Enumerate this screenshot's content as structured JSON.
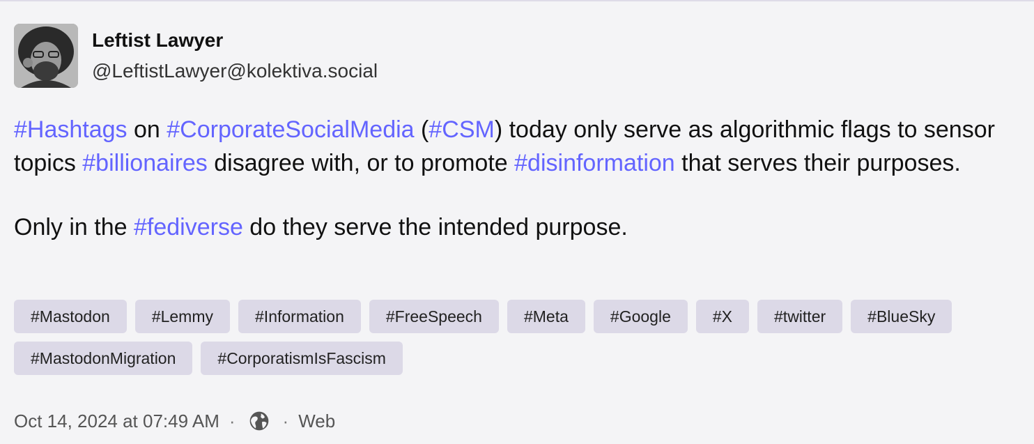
{
  "author": {
    "display_name": "Leftist Lawyer",
    "handle": "@LeftistLawyer@kolektiva.social",
    "avatar_icon": "avatar-photo"
  },
  "post": {
    "p1": {
      "tag_hashtags": "#Hashtags",
      "t_on": " on ",
      "tag_csm_full": "#CorporateSocialMedia",
      "t_open": " (",
      "tag_csm": "#CSM",
      "t_mid1": ") today only serve as algorithmic flags to sensor topics ",
      "tag_billionaires": "#billionaires",
      "t_mid2": " disagree with, or to promote ",
      "tag_disinfo": "#disinformation",
      "t_end": " that serves their purposes."
    },
    "p2": {
      "t_start": "Only in the ",
      "tag_fediverse": "#fediverse",
      "t_end": " do they serve the intended purpose."
    }
  },
  "tags": {
    "row1": [
      "#Mastodon",
      "#Lemmy",
      "#Information",
      "#FreeSpeech",
      "#Meta",
      "#Google",
      "#X",
      "#twitter",
      "#BlueSky"
    ],
    "row2": [
      "#MastodonMigration",
      "#CorporatismIsFascism"
    ]
  },
  "meta": {
    "timestamp": "Oct 14, 2024 at 07:49 AM",
    "separator": "·",
    "visibility_icon": "globe-icon",
    "application": "Web"
  },
  "colors": {
    "background": "#f4f4f6",
    "hashtag": "#6364ff",
    "tag_chip": "#dcd9e7"
  }
}
